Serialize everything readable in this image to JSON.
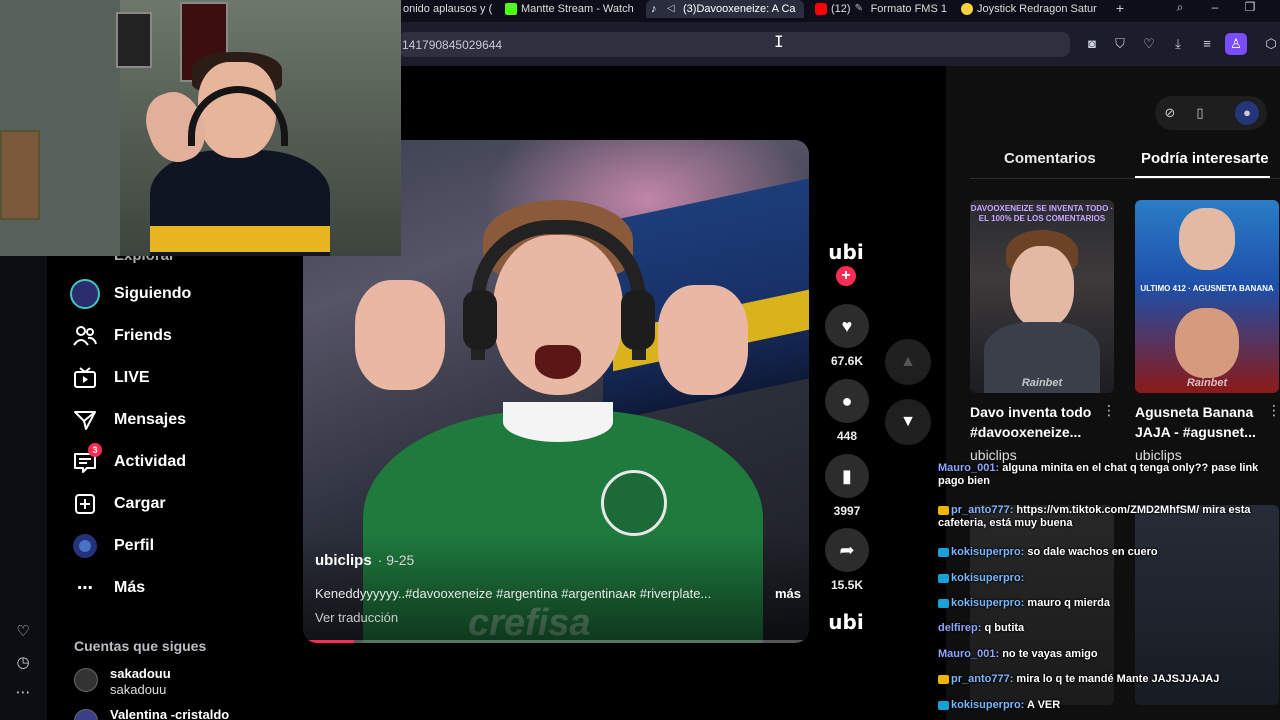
{
  "browser": {
    "tabs": [
      {
        "label": "onido aplausos y (",
        "icon": "audio-tab-icon",
        "color": "#888888"
      },
      {
        "label": "Mantte Stream - Watch",
        "icon": "kick-icon",
        "color": "#53fc18"
      },
      {
        "label": "(3)Davooxeneize: A Ca",
        "icon": "tiktok-icon",
        "color": "#ffffff",
        "active": true
      },
      {
        "label": "(12)",
        "icon": "youtube-icon",
        "color": "#ff0000"
      },
      {
        "label": "Formato FMS 1",
        "icon": "pen-icon",
        "color": "#bbbbbb"
      },
      {
        "label": "Joystick Redragon Satur",
        "icon": "shop-icon",
        "color": "#f7d23e"
      }
    ],
    "url": "141790845029644"
  },
  "nav": {
    "partial_top": "Explorar",
    "items": [
      {
        "label": "Siguiendo",
        "icon": "following-avatar-icon"
      },
      {
        "label": "Friends",
        "icon": "friends-icon"
      },
      {
        "label": "LIVE",
        "icon": "live-icon"
      },
      {
        "label": "Mensajes",
        "icon": "messages-icon"
      },
      {
        "label": "Actividad",
        "icon": "activity-icon",
        "badge": "3"
      },
      {
        "label": "Cargar",
        "icon": "upload-icon"
      },
      {
        "label": "Perfil",
        "icon": "profile-icon"
      },
      {
        "label": "Más",
        "icon": "more-icon"
      }
    ],
    "following_title": "Cuentas que sigues",
    "accounts": [
      {
        "name": "sakadouu",
        "sub": "sakadouu"
      },
      {
        "name": "Valentina -cristaldo",
        "sub": ""
      }
    ]
  },
  "video": {
    "author": "ubiclips",
    "date": "9-25",
    "caption": "Keneddyyyyyy..#davooxeneize #argentina #argentinaᴀʀ #riverplate...",
    "more": "más",
    "translate": "Ver traducción",
    "sponsor": "crefisa",
    "progress_fraction": 0.1
  },
  "actions": {
    "channel_logo": "ubi",
    "likes": "67.6K",
    "comments": "448",
    "saves": "3997",
    "shares": "15.5K"
  },
  "right_panel": {
    "tabs": [
      "Comentarios",
      "Podría interesarte"
    ],
    "active_tab": 1,
    "recommendations": [
      {
        "title": "Davo inventa todo #davooxeneize...",
        "author": "ubiclips",
        "thumb_caption": "DAVOOXENEIZE SE INVENTA TODO · EL 100% DE LOS COMENTARIOS",
        "brand": "Rainbet"
      },
      {
        "title": "Agusneta Banana JAJA - #agusnet...",
        "author": "ubiclips",
        "thumb_caption": "ULTIMO 412 · AGUSNETA BANANA",
        "brand": "Rainbet"
      }
    ]
  },
  "chat": [
    {
      "user": "Mauro_001",
      "user_color": "#8ea6ff",
      "msg": "alguna minita en el chat q tenga only?? pase link pago bien",
      "icon": ""
    },
    {
      "user": "pr_anto777",
      "user_color": "#7fb6ff",
      "msg": "https://vm.tiktok.com/ZMD2MhfSM/ mira esta cafeteria, está muy buena",
      "icon": "#f0b400"
    },
    {
      "user": "kokisuperpro",
      "user_color": "#77b7ff",
      "msg": "so dale wachos en cuero",
      "icon": "#1aa0d8"
    },
    {
      "user": "kokisuperpro",
      "user_color": "#77b7ff",
      "msg": "",
      "icon": "#1aa0d8"
    },
    {
      "user": "kokisuperpro",
      "user_color": "#77b7ff",
      "msg": "mauro q mierda",
      "icon": "#1aa0d8"
    },
    {
      "user": "delfirep",
      "user_color": "#8ea6ff",
      "msg": "q butita",
      "icon": ""
    },
    {
      "user": "Mauro_001",
      "user_color": "#8ea6ff",
      "msg": "no te vayas amigo",
      "icon": ""
    },
    {
      "user": "pr_anto777",
      "user_color": "#7fb6ff",
      "msg": "mira lo q te mandé Mante JAJSJJAJAJ",
      "icon": "#f0b400"
    },
    {
      "user": "kokisuperpro",
      "user_color": "#77b7ff",
      "msg": "A VER",
      "icon": "#1aa0d8"
    }
  ],
  "colors": {
    "accent": "#fe2c55",
    "brave_profile": "#7c4dff"
  }
}
